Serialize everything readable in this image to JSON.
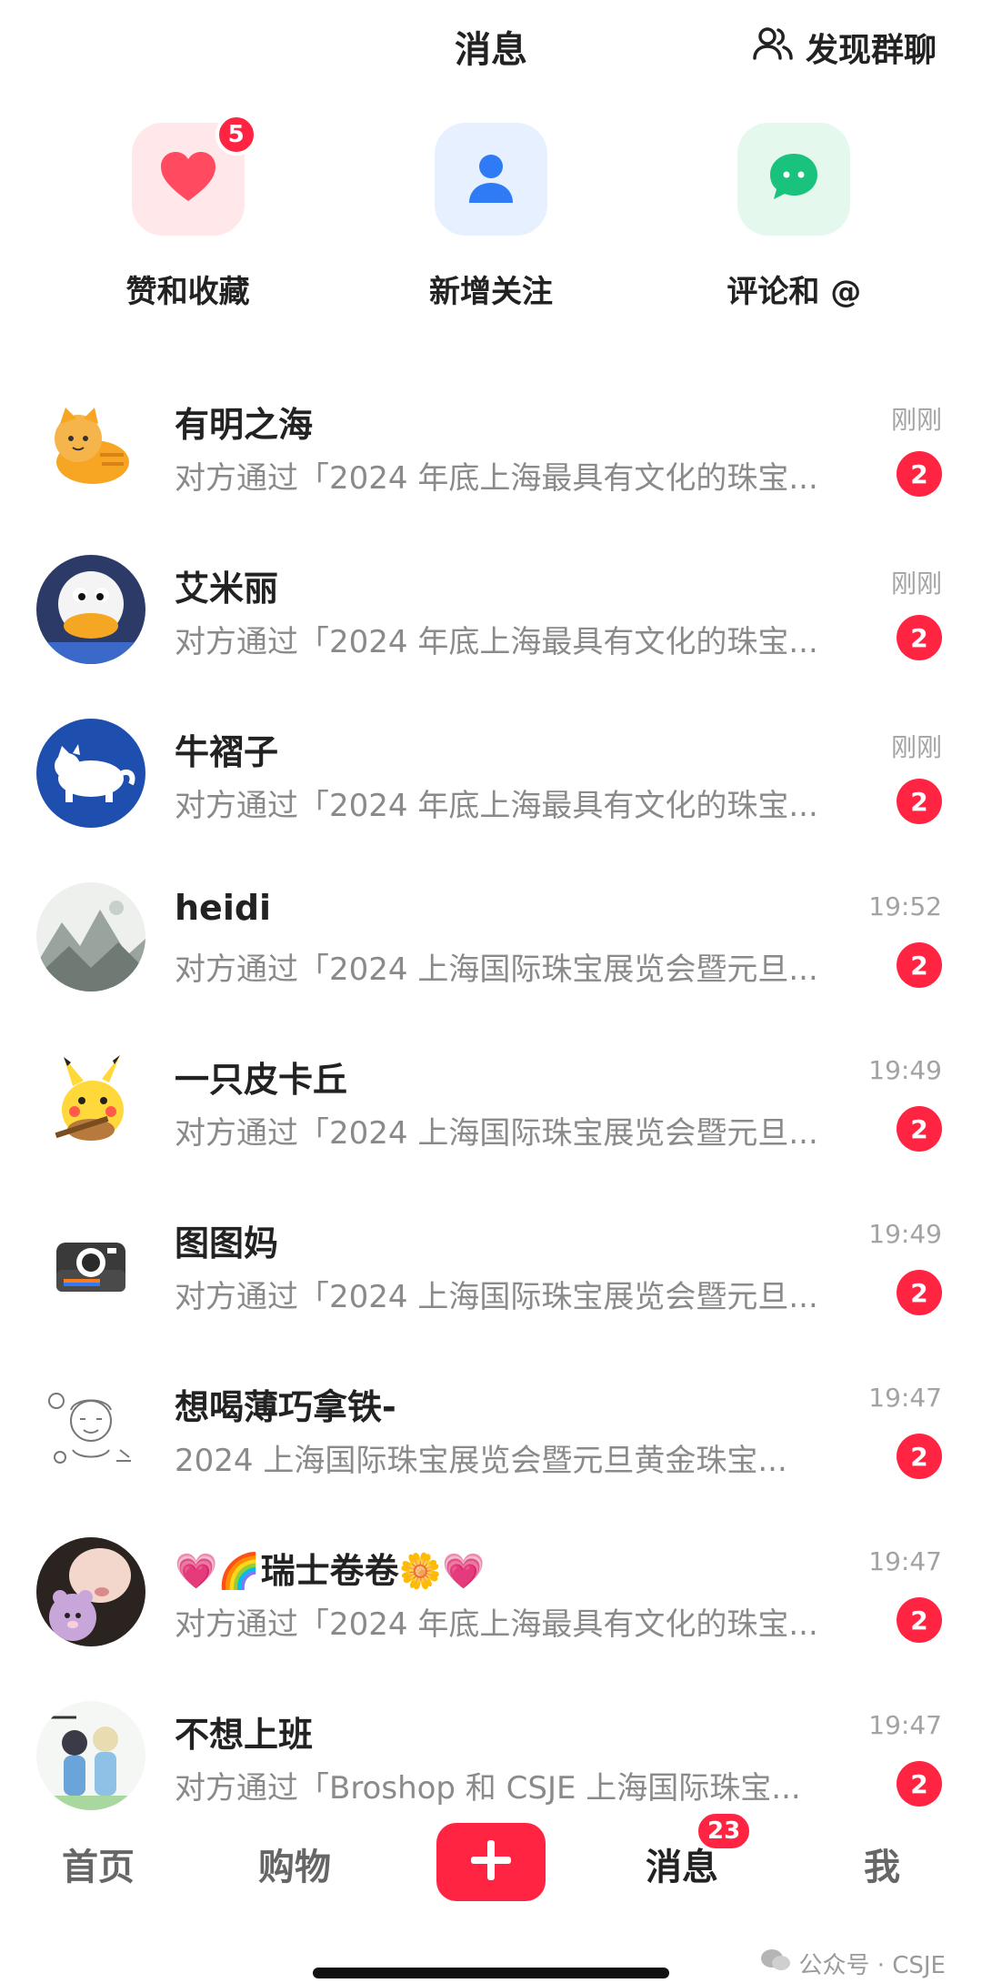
{
  "header": {
    "title": "消息",
    "discover_label": "发现群聊"
  },
  "quick_actions": [
    {
      "label": "赞和收藏",
      "badge": "5",
      "icon": "heart-icon"
    },
    {
      "label": "新增关注",
      "badge": "",
      "icon": "person-icon"
    },
    {
      "label": "评论和 @",
      "badge": "",
      "icon": "chat-bubble-icon"
    }
  ],
  "messages": [
    {
      "name": "有明之海",
      "preview": "对方通过「2024 年底上海最具有文化的珠宝...",
      "time": "刚刚",
      "unread": "2",
      "avatar": "orange-cat-avatar"
    },
    {
      "name": "艾米丽",
      "preview": "对方通过「2024 年底上海最具有文化的珠宝...",
      "time": "刚刚",
      "unread": "2",
      "avatar": "donald-duck-avatar"
    },
    {
      "name": "牛褶子",
      "preview": "对方通过「2024 年底上海最具有文化的珠宝...",
      "time": "刚刚",
      "unread": "2",
      "avatar": "white-cat-blue-avatar"
    },
    {
      "name": "heidi",
      "preview": "对方通过「2024 上海国际珠宝展览会暨元旦...",
      "time": "19:52",
      "unread": "2",
      "avatar": "ink-landscape-avatar"
    },
    {
      "name": "一只皮卡丘",
      "preview": "对方通过「2024 上海国际珠宝展览会暨元旦...",
      "time": "19:49",
      "unread": "2",
      "avatar": "pikachu-guitar-avatar"
    },
    {
      "name": "图图妈",
      "preview": "对方通过「2024 上海国际珠宝展览会暨元旦...",
      "time": "19:49",
      "unread": "2",
      "avatar": "camera-avatar"
    },
    {
      "name": "想喝薄巧拿铁-",
      "preview": "2024 上海国际珠宝展览会暨元旦黄金珠宝...",
      "time": "19:47",
      "unread": "2",
      "avatar": "sketch-doodle-avatar"
    },
    {
      "name": "💗🌈瑞士卷卷🌼💗",
      "preview": "对方通过「2024 年底上海最具有文化的珠宝...",
      "time": "19:47",
      "unread": "2",
      "avatar": "girl-bear-hat-avatar"
    },
    {
      "name": "不想上班",
      "preview": "对方通过「Broshop 和 CSJE 上海国际珠宝...",
      "time": "19:47",
      "unread": "2",
      "avatar": "anime-couple-avatar"
    }
  ],
  "tabbar": {
    "home": "首页",
    "shopping": "购物",
    "messages": "消息",
    "messages_badge": "23",
    "me": "我"
  },
  "watermark": "公众号 · CSJE",
  "colors": {
    "accent": "#ff2442",
    "like_bg": "#ffe7ea",
    "follow_bg": "#e6f0ff",
    "comment_bg": "#e4f8ee"
  }
}
